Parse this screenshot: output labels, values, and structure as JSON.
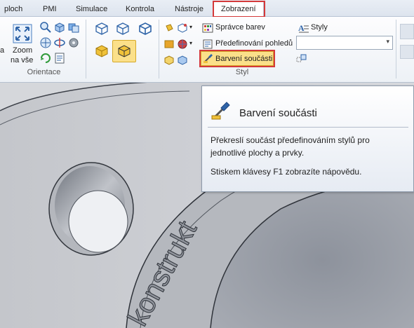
{
  "tabs": [
    "ploch",
    "PMI",
    "Simulace",
    "Kontrola",
    "Nástroje",
    "Zobrazení"
  ],
  "active_tab": "Zobrazení",
  "orientation_group": {
    "label": "Orientace",
    "zoom_all_label_line1": "Zoom",
    "zoom_all_label_line2": "na vše",
    "partial_label": "a"
  },
  "style_group": {
    "label": "Styl",
    "color_manager": "Správce barev",
    "view_override": "Předefinování pohledů",
    "part_painter": "Barvení součásti",
    "styles": "Styly",
    "style_dropdown_value": ""
  },
  "tooltip": {
    "title": "Barvení součásti",
    "description": "Překreslí součást předefinováním stylů pro jednotlivé plochy a prvky.",
    "help": "Stiskem klávesy F1 zobrazíte nápovědu."
  },
  "model": {
    "engraved_text": "konstrukt"
  },
  "colors": {
    "highlight": "#d4393a",
    "ribbon_bg": "#edf1f6",
    "model_gray": "#b9bcc2"
  },
  "icons": [
    "zoom-all-icon",
    "zoom-area-icon",
    "view-cube-icon",
    "pan-icon",
    "rotate-icon",
    "wireframe-icon",
    "shaded-icon",
    "color-manager-icon",
    "part-painter-icon",
    "styles-icon"
  ]
}
